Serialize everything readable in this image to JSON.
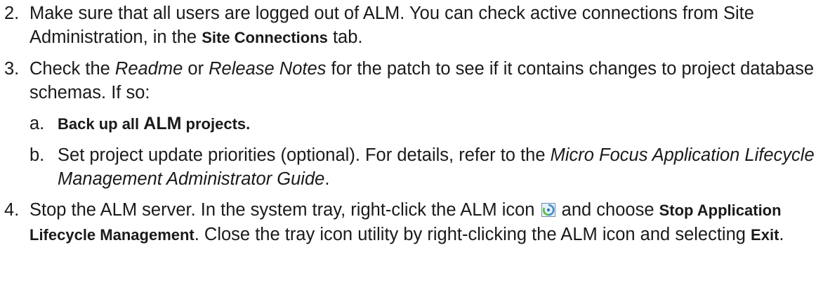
{
  "steps": [
    {
      "number": "2.",
      "text_1": "Make sure that all users are logged out of ALM. You can check active connections from Site Administration, in the ",
      "ui_1": "Site Connections",
      "text_2": " tab."
    },
    {
      "number": "3.",
      "text_1": "Check the ",
      "italic_1": "Readme",
      "text_2": " or ",
      "italic_2": "Release Notes",
      "text_3": " for the patch to see if it contains changes to project database schemas. If so:",
      "substeps": [
        {
          "letter": "a.",
          "link_1": "Back up all ",
          "link_big": "ALM",
          "link_2": " projects."
        },
        {
          "letter": "b.",
          "text_1": "Set project update priorities (optional). For details, refer to the ",
          "italic_1": "Micro Focus Application Lifecycle Management Administrator Guide",
          "text_2": "."
        }
      ]
    },
    {
      "number": "4.",
      "text_1": "Stop the ALM server. In the system tray, right-click the ALM icon ",
      "icon": "alm-tray-icon",
      "text_2": " and choose ",
      "ui_1": "Stop Application Lifecycle Management",
      "text_3": ". Close the tray icon utility by right-clicking the ALM icon and selecting ",
      "ui_2": "Exit",
      "text_4": "."
    }
  ]
}
